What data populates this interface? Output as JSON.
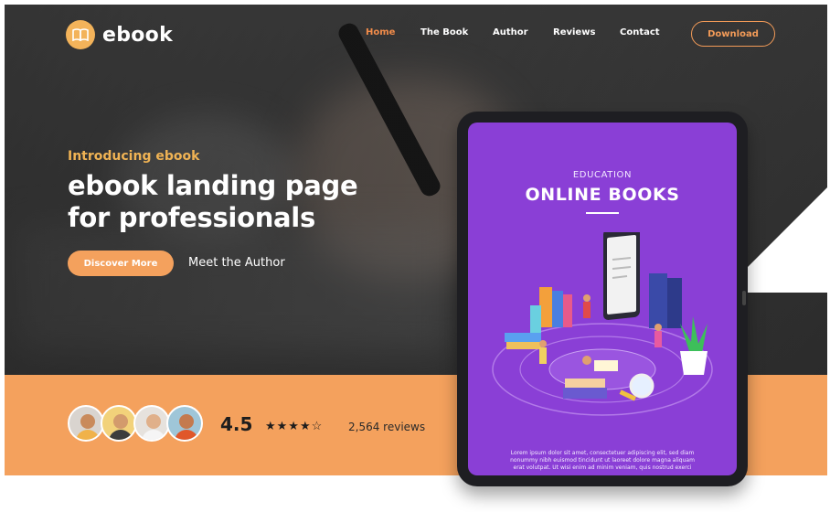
{
  "brand": {
    "name": "ebook",
    "accent": "#f4a15d",
    "gold": "#f0b354",
    "logo_icon": "open-book-icon"
  },
  "nav": {
    "items": [
      {
        "label": "Home",
        "active": true
      },
      {
        "label": "The Book",
        "active": false
      },
      {
        "label": "Author",
        "active": false
      },
      {
        "label": "Reviews",
        "active": false
      },
      {
        "label": "Contact",
        "active": false
      }
    ],
    "cta": "Download"
  },
  "hero": {
    "eyebrow": "Introducing ebook",
    "headline_line1": "ebook landing page",
    "headline_line2": "for professionals",
    "primary_button": "Discover More",
    "secondary_link": "Meet the Author"
  },
  "social_proof": {
    "rating": "4.5",
    "stars": "★★★★☆",
    "reviews": "2,564 reviews",
    "avatar_count": 4
  },
  "tablet": {
    "screen_color": "#8a3fd6",
    "eyebrow": "EDUCATION",
    "title": "ONLINE BOOKS",
    "body": "Lorem ipsum dolor sit amet, consectetuer adipiscing elit, sed diam nonummy nibh euismod tincidunt ut laoreet dolore magna aliquam erat volutpat. Ut wisi enim ad minim veniam, quis nostrud exerci"
  }
}
